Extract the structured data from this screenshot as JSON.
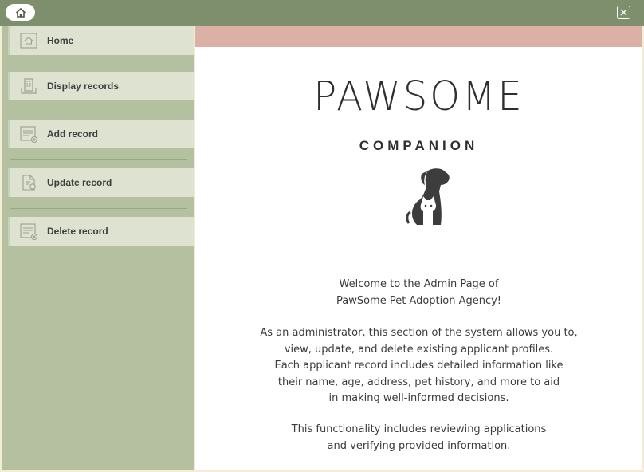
{
  "titlebar": {
    "home_icon": "home-icon",
    "close_icon": "close-icon"
  },
  "sidebar": {
    "items": [
      {
        "label": "Home",
        "icon": "home-icon"
      },
      {
        "label": "Display records",
        "icon": "building-icon"
      },
      {
        "label": "Add record",
        "icon": "add-document-icon"
      },
      {
        "label": "Update record",
        "icon": "edit-document-icon"
      },
      {
        "label": "Delete record",
        "icon": "delete-document-icon"
      }
    ]
  },
  "logo": {
    "title": "PAWSOME",
    "subtitle": "COMPANION"
  },
  "welcome": {
    "line1": "Welcome to the Admin Page of",
    "line2": "PawSome Pet Adoption Agency!"
  },
  "description": {
    "line1": "As an administrator, this section of the system allows you to,",
    "line2": "view, update, and delete existing applicant profiles.",
    "line3": "Each applicant record includes detailed information like",
    "line4": "their name, age, address, pet history, and more to aid",
    "line5": "in making well-informed decisions."
  },
  "functionality": {
    "line1": "This functionality includes reviewing applications",
    "line2": "and verifying provided information."
  },
  "colors": {
    "titlebar": "#7d8f6c",
    "sidebar": "#b5c0a0",
    "nav_item": "#dde2d1",
    "accent_bar": "#dbb1a5"
  }
}
